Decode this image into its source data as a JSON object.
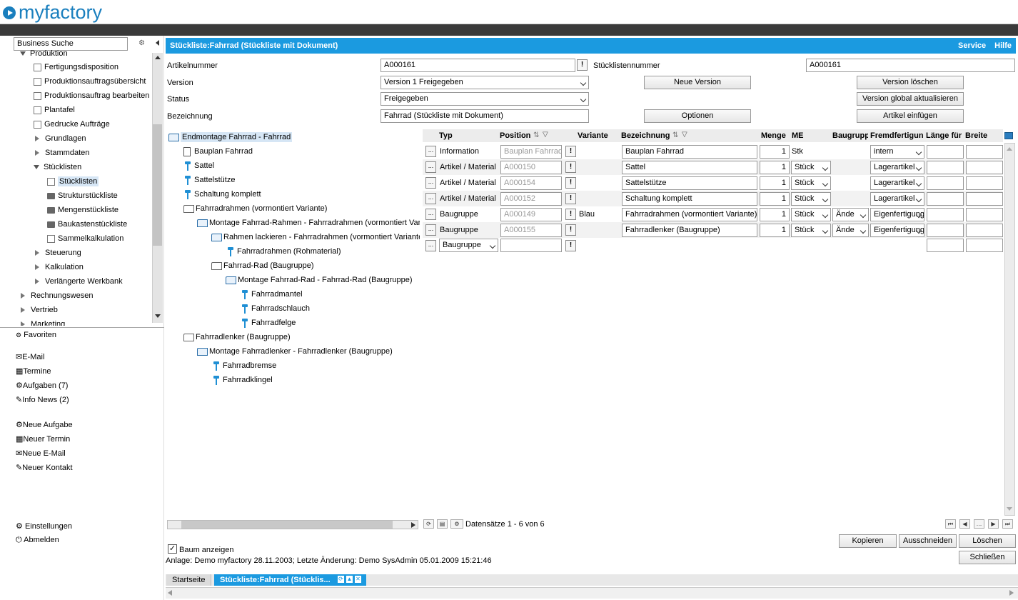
{
  "app": {
    "logo_text": "myfactory"
  },
  "sidebar": {
    "search_value": "Business Suche",
    "tree": [
      {
        "label": "Produktion",
        "level": 0
      },
      {
        "label": "Fertigungsdisposition"
      },
      {
        "label": "Produktionsauftragsübersicht"
      },
      {
        "label": "Produktionsauftrag bearbeiten"
      },
      {
        "label": "Plantafel"
      },
      {
        "label": "Gedrucke Aufträge"
      },
      {
        "label": "Grundlagen"
      },
      {
        "label": "Stammdaten"
      },
      {
        "label": "Stücklisten"
      },
      {
        "label": "Stücklisten"
      },
      {
        "label": "Strukturstückliste"
      },
      {
        "label": "Mengenstückliste"
      },
      {
        "label": "Baukastenstückliste"
      },
      {
        "label": "Sammelkalkulation"
      },
      {
        "label": "Steuerung"
      },
      {
        "label": "Kalkulation"
      },
      {
        "label": "Verlängerte Werkbank"
      },
      {
        "label": "Rechnungswesen"
      },
      {
        "label": "Vertrieb"
      },
      {
        "label": "Marketing"
      }
    ],
    "links": {
      "favoriten": "Favoriten",
      "email": "E-Mail",
      "termine": "Termine",
      "aufgaben": "Aufgaben (7)",
      "infonews": "Info News (2)",
      "neue_aufgabe": "Neue Aufgabe",
      "neuer_termin": "Neuer Termin",
      "neue_email": "Neue E-Mail",
      "neuer_kontakt": "Neuer Kontakt",
      "einstellungen": "Einstellungen",
      "abmelden": "Abmelden"
    }
  },
  "window": {
    "title": "Stückliste:Fahrrad (Stückliste mit Dokument)",
    "service": "Service",
    "hilfe": "Hilfe"
  },
  "form": {
    "artikelnummer_label": "Artikelnummer",
    "artikelnummer_value": "A000161",
    "stuecklistennummer_label": "Stücklistennummer",
    "stuecklistennummer_value": "A000161",
    "version_label": "Version",
    "version_value": "Version 1 Freigegeben",
    "status_label": "Status",
    "status_value": "Freigegeben",
    "bezeichnung_label": "Bezeichnung",
    "bezeichnung_value": "Fahrrad (Stückliste mit Dokument)",
    "btn_neue_version": "Neue Version",
    "btn_version_loeschen": "Version löschen",
    "btn_version_global": "Version global aktualisieren",
    "btn_optionen": "Optionen",
    "btn_artikel_einfuegen": "Artikel einfügen"
  },
  "bomtree": [
    {
      "label": "Endmontage Fahrrad - Fahrrad",
      "type": "asm"
    },
    {
      "label": "Bauplan Fahrrad",
      "type": "doc"
    },
    {
      "label": "Sattel",
      "type": "part"
    },
    {
      "label": "Sattelstütze",
      "type": "part"
    },
    {
      "label": "Schaltung komplett",
      "type": "part"
    },
    {
      "label": "Fahrradrahmen (vormontiert Variante)",
      "type": "folder"
    },
    {
      "label": "Montage Fahrrad-Rahmen - Fahrradrahmen (vormontiert Variante)",
      "type": "asm"
    },
    {
      "label": "Rahmen lackieren - Fahrradrahmen (vormontiert Variante)",
      "type": "asm"
    },
    {
      "label": "Fahrradrahmen (Rohmaterial)",
      "type": "part"
    },
    {
      "label": "Fahrrad-Rad (Baugruppe)",
      "type": "folder"
    },
    {
      "label": "Montage Fahrrad-Rad - Fahrrad-Rad (Baugruppe)",
      "type": "asm"
    },
    {
      "label": "Fahrradmantel",
      "type": "part"
    },
    {
      "label": "Fahrradschlauch",
      "type": "part"
    },
    {
      "label": "Fahrradfelge",
      "type": "part"
    },
    {
      "label": "Fahrradlenker (Baugruppe)",
      "type": "folder"
    },
    {
      "label": "Montage Fahrradlenker - Fahrradlenker (Baugruppe)",
      "type": "asm"
    },
    {
      "label": "Fahrradbremse",
      "type": "part"
    },
    {
      "label": "Fahrradklingel",
      "type": "part"
    }
  ],
  "grid": {
    "headers": {
      "typ": "Typ",
      "position": "Position",
      "variante": "Variante",
      "bezeichnung": "Bezeichnung",
      "menge": "Menge",
      "me": "ME",
      "baugruppe": "Baugruppe",
      "fremdfertigung": "Fremdfertigung",
      "laenge": "Länge für",
      "breite": "Breite"
    },
    "rows": [
      {
        "typ": "Information",
        "position": "Bauplan Fahrrad",
        "variante": "",
        "bezeichnung": "Bauplan Fahrrad",
        "menge": "1",
        "me": "Stk",
        "baugruppe": "",
        "fremd": "intern"
      },
      {
        "typ": "Artikel / Material",
        "position": "A000150",
        "variante": "",
        "bezeichnung": "Sattel",
        "menge": "1",
        "me": "Stück",
        "baugruppe": "",
        "fremd": "Lagerartikel"
      },
      {
        "typ": "Artikel / Material",
        "position": "A000154",
        "variante": "",
        "bezeichnung": "Sattelstütze",
        "menge": "1",
        "me": "Stück",
        "baugruppe": "",
        "fremd": "Lagerartikel"
      },
      {
        "typ": "Artikel / Material",
        "position": "A000152",
        "variante": "",
        "bezeichnung": "Schaltung komplett",
        "menge": "1",
        "me": "Stück",
        "baugruppe": "",
        "fremd": "Lagerartikel"
      },
      {
        "typ": "Baugruppe",
        "position": "A000149",
        "variante": "Blau",
        "bezeichnung": "Fahrradrahmen (vormontiert Variante)",
        "menge": "1",
        "me": "Stück",
        "baugruppe": "Ände",
        "fremd": "Eigenfertigung"
      },
      {
        "typ": "Baugruppe",
        "position": "A000155",
        "variante": "",
        "bezeichnung": "Fahrradlenker (Baugruppe)",
        "menge": "1",
        "me": "Stück",
        "baugruppe": "Ände",
        "fremd": "Eigenfertigung"
      }
    ],
    "new_row_typ": "Baugruppe",
    "records": "Datensätze 1 - 6 von 6"
  },
  "footer": {
    "baum_anzeigen": "Baum anzeigen",
    "anlage": "Anlage: Demo myfactory 28.11.2003; Letzte Änderung: Demo SysAdmin 05.01.2009 15:21:46",
    "btn_kopieren": "Kopieren",
    "btn_ausschneiden": "Ausschneiden",
    "btn_loeschen": "Löschen",
    "btn_schliessen": "Schließen"
  },
  "tabs": {
    "startseite": "Startseite",
    "active": "Stückliste:Fahrrad (Stücklis..."
  }
}
